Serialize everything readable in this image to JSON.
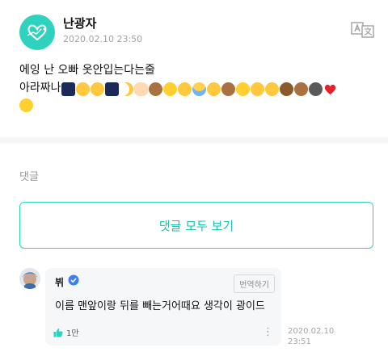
{
  "post": {
    "author": "난광자",
    "date": "2020.02.10 23:50",
    "text_line1": "에잉 난 오빠 옷안입는다는줄",
    "text_line2_prefix": "아라짜나",
    "emojis_line2": [
      "night-stars",
      "heart-eyes",
      "heart-eyes",
      "night-stars",
      "crescent-moon",
      "hands",
      "see-no-evil-monkey",
      "full-moon",
      "grinning-sweat",
      "screaming",
      "grinning-sweat",
      "speak-no-evil-monkey",
      "full-moon",
      "smiling",
      "grinning-sweat",
      "bear",
      "see-no-evil-monkey",
      "new-moon",
      "red-heart"
    ],
    "emojis_line3": [
      "full-moon"
    ]
  },
  "comments": {
    "label": "댓글",
    "view_all": "댓글 모두 보기"
  },
  "comment": {
    "author": "뷔",
    "translate": "번역하기",
    "text": "이름 맨앞이랑 뒤를 빼는거어때요 생각이 광이드",
    "likes": "1만",
    "more": "⋮",
    "time_line1": "2020.02.10",
    "time_line2": "23:51"
  },
  "colors": {
    "accent": "#2fd2bd",
    "accent_text": "#1ec2ac"
  }
}
